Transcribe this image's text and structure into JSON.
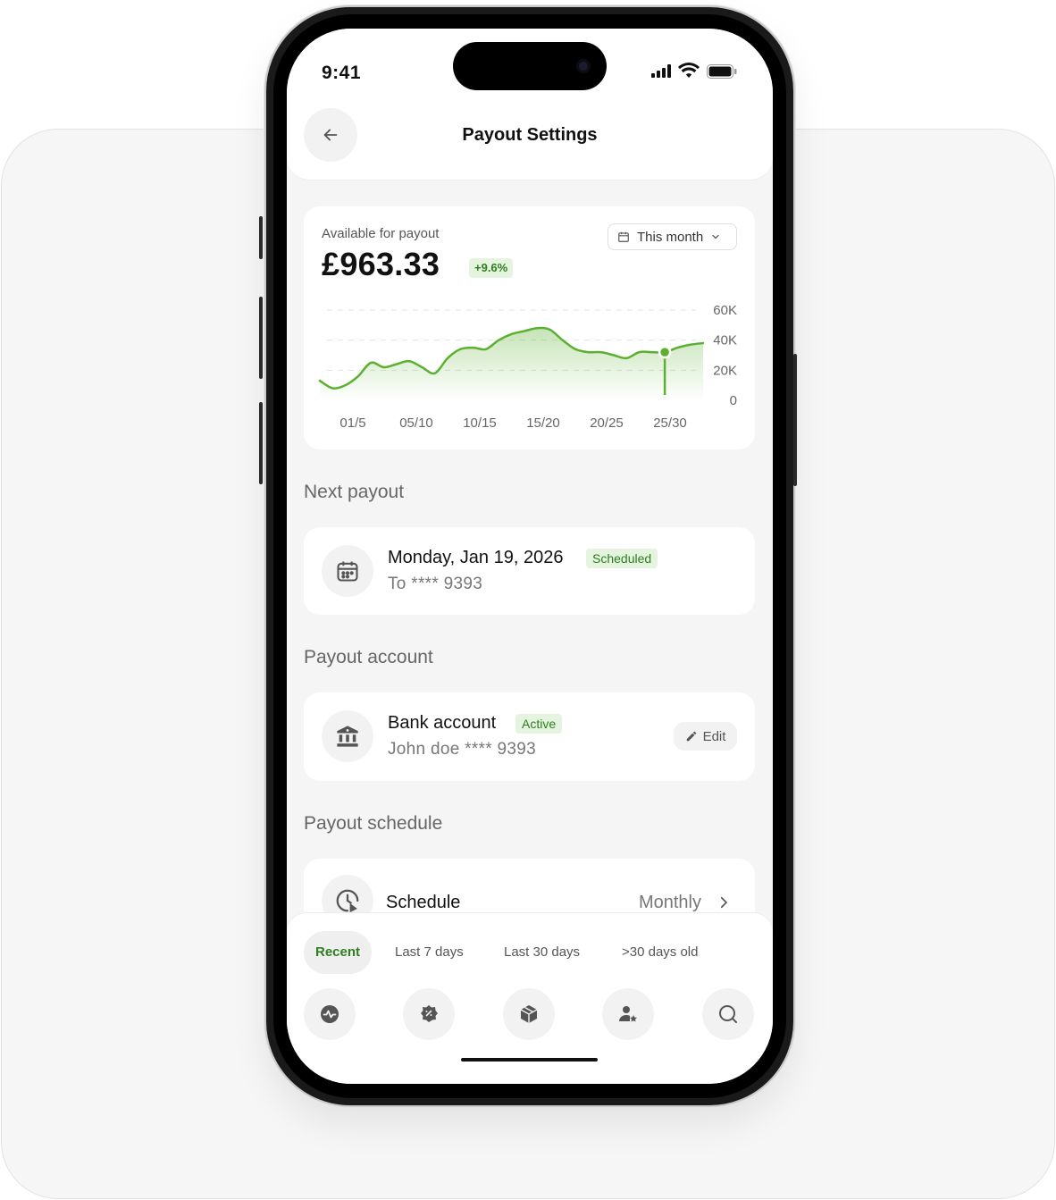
{
  "status_bar": {
    "time": "9:41"
  },
  "header": {
    "title": "Payout Settings"
  },
  "balance": {
    "label": "Available for payout",
    "amount": "£963.33",
    "change": "+9.6%",
    "range_label": "This month"
  },
  "chart_data": {
    "type": "area",
    "x_ticks": [
      "01/5",
      "05/10",
      "10/15",
      "15/20",
      "20/25",
      "25/30"
    ],
    "y_ticks": [
      "60K",
      "40K",
      "20K",
      "0"
    ],
    "ylim": [
      0,
      60000
    ],
    "grid": true,
    "series": [
      {
        "values": [
          13000,
          8000,
          10000,
          16000,
          25000,
          22000,
          24000,
          26000,
          22000,
          18000,
          28000,
          34000,
          35000,
          34000,
          40000,
          44000,
          46000,
          48000,
          47000,
          40000,
          34000,
          32000,
          32000,
          30000,
          28000,
          32000,
          32000,
          32000,
          35000,
          37000,
          38000
        ]
      }
    ],
    "highlight_index": 27,
    "line_color": "#5bb030"
  },
  "next_payout": {
    "section_title": "Next payout",
    "date": "Monday, Jan 19, 2026",
    "status": "Scheduled",
    "destination": "To **** 9393"
  },
  "payout_account": {
    "section_title": "Payout account",
    "name": "Bank account",
    "status": "Active",
    "detail": "John doe **** 9393",
    "edit_label": "Edit"
  },
  "payout_schedule": {
    "section_title": "Payout schedule",
    "label": "Schedule",
    "value": "Monthly"
  },
  "filters": [
    "Recent",
    "Last 7 days",
    "Last 30 days",
    ">30 days old"
  ],
  "nav_icons": [
    "activity-icon",
    "discount-tag-icon",
    "package-icon",
    "user-star-icon",
    "search-icon"
  ],
  "colors": {
    "accent": "#5bb030",
    "accent_text": "#2e7d1e",
    "badge_bg": "#e4f4df"
  }
}
